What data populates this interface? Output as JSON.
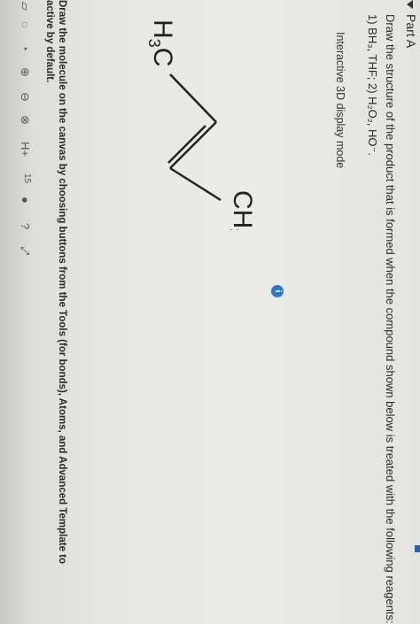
{
  "part": {
    "label": "Part A"
  },
  "question": {
    "line1": "Draw the structure of the product that is formed when the compound shown below is treated with the following reagents:",
    "line2": "1) BH₃, THF; 2) H₂O₂, HO⁻."
  },
  "display_mode": {
    "label": "Interactive 3D display mode"
  },
  "info_icon": {
    "glyph": "i"
  },
  "molecule": {
    "left_group": {
      "main": "H",
      "sub": "3",
      "tail": "C"
    },
    "right_group": {
      "main": "CH",
      "sub": "3"
    }
  },
  "instructions": {
    "line1": "Draw the molecule on the canvas by choosing buttons from the Tools (for bonds), Atoms, and Advanced Template to",
    "line2": "active by default."
  },
  "toolbar": {
    "item_15": "15",
    "item_h": "H+"
  },
  "colors": {
    "accent": "#2f76c9",
    "corner": "#2f5fb0"
  }
}
